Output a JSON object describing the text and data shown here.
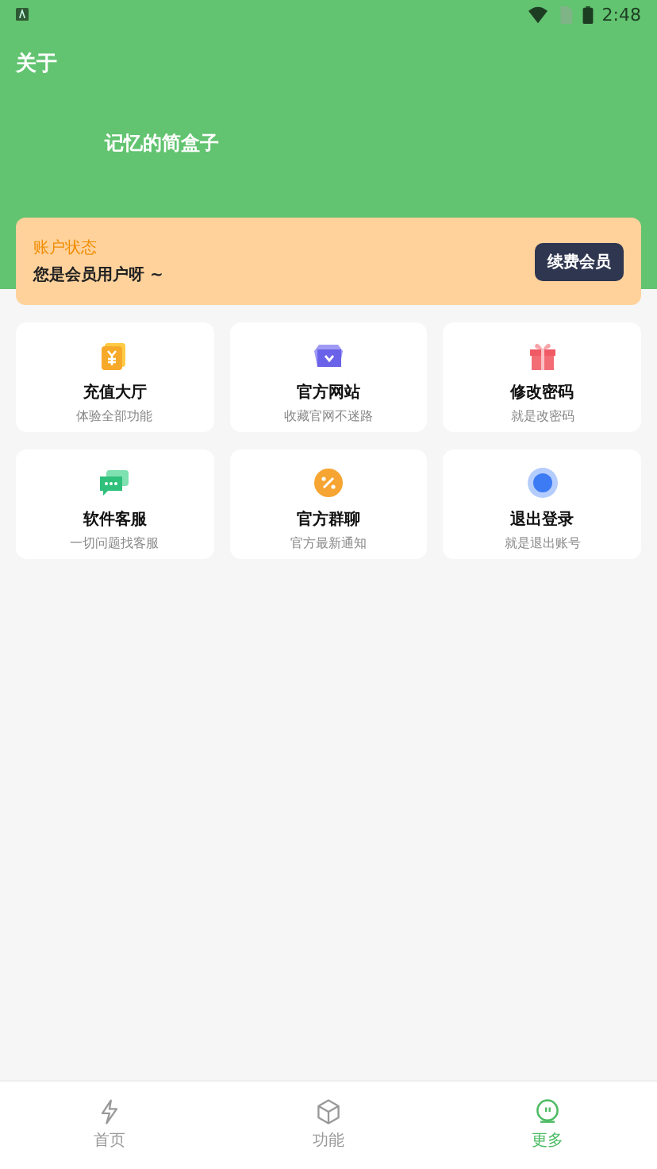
{
  "status_bar": {
    "time": "2:48"
  },
  "header": {
    "title": "关于",
    "app_name": "记忆的简盒子"
  },
  "member_card": {
    "label": "账户状态",
    "message": "您是会员用户呀 ~",
    "button": "续费会员"
  },
  "tiles": [
    {
      "kind": "coin",
      "title": "充值大厅",
      "subtitle": "体验全部功能"
    },
    {
      "kind": "web",
      "title": "官方网站",
      "subtitle": "收藏官网不迷路"
    },
    {
      "kind": "gift",
      "title": "修改密码",
      "subtitle": "就是改密码"
    },
    {
      "kind": "chat",
      "title": "软件客服",
      "subtitle": "一切问题找客服"
    },
    {
      "kind": "percent",
      "title": "官方群聊",
      "subtitle": "官方最新通知"
    },
    {
      "kind": "logout",
      "title": "退出登录",
      "subtitle": "就是退出账号"
    }
  ],
  "bottom_nav": [
    {
      "kind": "bolt",
      "label": "首页",
      "selected": false
    },
    {
      "kind": "box",
      "label": "功能",
      "selected": false
    },
    {
      "kind": "robot",
      "label": "更多",
      "selected": true
    }
  ]
}
